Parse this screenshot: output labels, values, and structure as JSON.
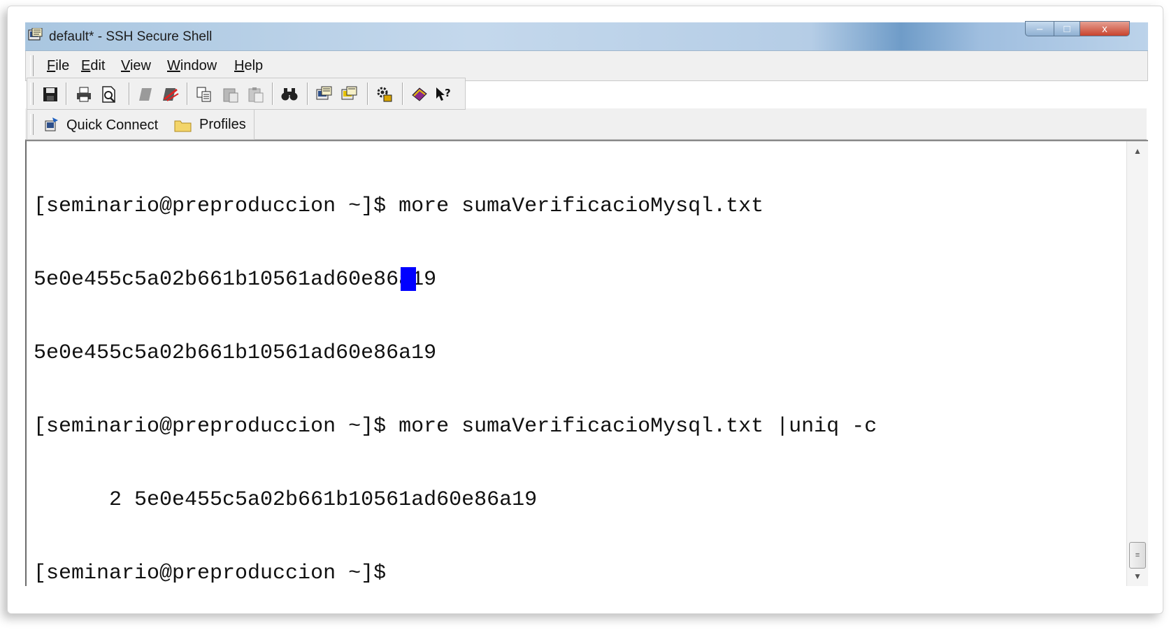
{
  "window": {
    "title": "default* - SSH Secure Shell",
    "minimize_symbol": "–",
    "maximize_symbol": "□",
    "close_symbol": "x"
  },
  "menu": {
    "items": [
      {
        "label_first": "F",
        "label_rest": "ile"
      },
      {
        "label_first": "E",
        "label_rest": "dit"
      },
      {
        "label_first": "V",
        "label_rest": "iew"
      },
      {
        "label_first": "W",
        "label_rest": "indow"
      },
      {
        "label_first": "H",
        "label_rest": "elp"
      }
    ]
  },
  "toolbar": {
    "icons": [
      "save-icon",
      "print-icon",
      "print-preview-icon",
      "disconnect-icon",
      "reconnect-icon",
      "copy-icon",
      "paste-icon",
      "paste-alt-icon",
      "find-icon",
      "new-terminal-icon",
      "new-file-transfer-icon",
      "settings-icon",
      "help-book-icon",
      "context-help-icon"
    ]
  },
  "quickbar": {
    "quick_connect": "Quick Connect",
    "profiles": "Profiles"
  },
  "terminal": {
    "lines": [
      "[seminario@preproduccion ~]$ more sumaVerificacioMysql.txt",
      "5e0e455c5a02b661b10561ad60e86a19",
      "5e0e455c5a02b661b10561ad60e86a19",
      "[seminario@preproduccion ~]$ more sumaVerificacioMysql.txt |uniq -c",
      "      2 5e0e455c5a02b661b10561ad60e86a19",
      "[seminario@preproduccion ~]$ "
    ],
    "cursor_color": "#0000ff"
  },
  "scrollbar": {
    "up_arrow": "▲",
    "down_arrow": "▼",
    "thumb_grip": "≡"
  }
}
